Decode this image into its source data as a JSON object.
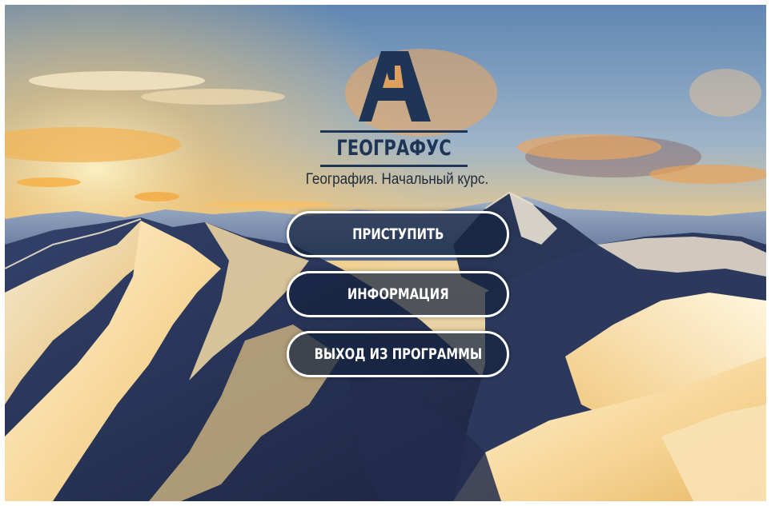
{
  "app": {
    "logo_text": "ГЕОГРАФУС",
    "subtitle": "География. Начальный курс.",
    "logo_color": "#1f3556"
  },
  "menu": {
    "start_label": "ПРИСТУПИТЬ",
    "info_label": "ИНФОРМАЦИЯ",
    "exit_label": "ВЫХОД ИЗ ПРОГРАММЫ"
  },
  "background": {
    "scene": "snowy mountains at sunset",
    "sky_color": "#7d9fc2",
    "glow_color": "#f3b55a",
    "shadow_color": "#26324f"
  }
}
